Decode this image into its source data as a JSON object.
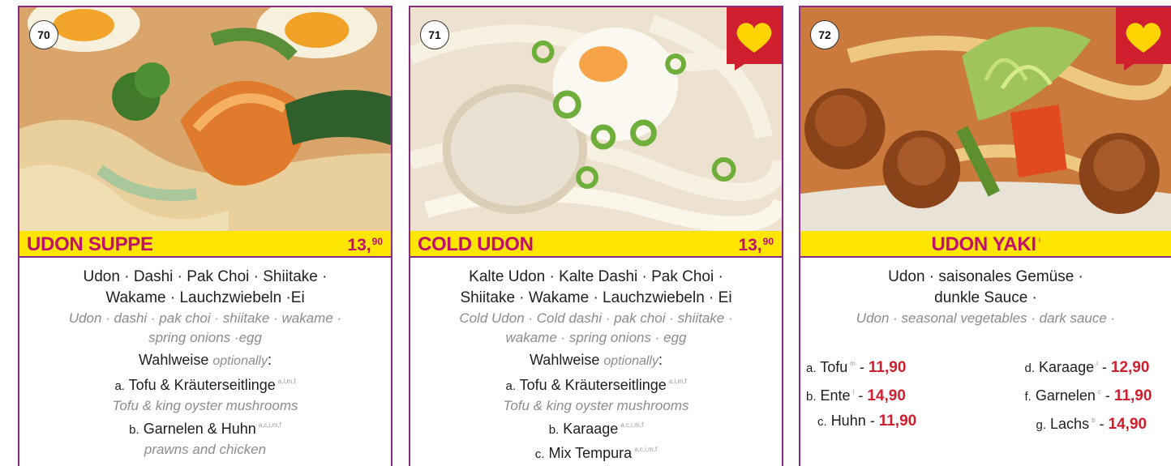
{
  "colors": {
    "border": "#8a2b86",
    "title": "#c0106c",
    "bar": "#ffe600",
    "price_red": "#cf1f2e",
    "heart_bg": "#cf1f2e",
    "heart": "#ffd400"
  },
  "cards": [
    {
      "number": "70",
      "name": "UDON SUPPE",
      "price_main": "13,",
      "price_cents": "90",
      "de": [
        "Udon · Dashi · Pak Choi · Shiitake ·",
        "Wakame · Lauchzwiebeln ·Ei"
      ],
      "en": [
        "Udon · dashi · pak choi · shiitake · wakame ·",
        "spring onions ·egg"
      ],
      "optional_de": "Wahlweise",
      "optional_en": "optionally",
      "options": [
        {
          "letter": "a.",
          "name": "Tofu & Kräuterseitlinge",
          "allergens": "a,i,m,f",
          "en": "Tofu & king oyster mushrooms"
        },
        {
          "letter": "b.",
          "name": "Garnelen & Huhn",
          "allergens": "a,c,i,m,f",
          "en": "prawns and chicken"
        }
      ]
    },
    {
      "number": "71",
      "name": "COLD UDON",
      "price_main": "13,",
      "price_cents": "90",
      "de": [
        "Kalte Udon · Kalte Dashi · Pak Choi ·",
        "Shiitake · Wakame · Lauchzwiebeln · Ei"
      ],
      "en": [
        "Cold Udon · Cold dashi · pak choi · shiitake ·",
        "wakame · spring onions · egg"
      ],
      "optional_de": "Wahlweise",
      "optional_en": "optionally",
      "options": [
        {
          "letter": "a.",
          "name": "Tofu & Kräuterseitlinge",
          "allergens": "a,i,m,f",
          "en": "Tofu & king oyster mushrooms"
        },
        {
          "letter": "b.",
          "name": "Karaage",
          "allergens": "a,c,i,m,f",
          "en": ""
        },
        {
          "letter": "c.",
          "name": "Mix Tempura",
          "allergens": "a,c,i,m,f",
          "en": ""
        }
      ]
    },
    {
      "number": "72",
      "name": "UDON YAKI",
      "name_allergen": "i",
      "de": [
        "Udon · saisonales Gemüse ·",
        "dunkle Sauce ·"
      ],
      "en": [
        "Udon · seasonal vegetables · dark sauce ·"
      ],
      "options": [
        {
          "letter": "a.",
          "name": "Tofu",
          "allergens": "m",
          "price": "11,90"
        },
        {
          "letter": "d.",
          "name": "Karaage",
          "allergens": "i",
          "price": "12,90"
        },
        {
          "letter": "b.",
          "name": "Ente",
          "allergens": "i",
          "price": "14,90"
        },
        {
          "letter": "f.",
          "name": "Garnelen",
          "allergens": "c",
          "price": "11,90"
        },
        {
          "letter": "c.",
          "name": "Huhn",
          "allergens": "",
          "price": "11,90"
        },
        {
          "letter": "g.",
          "name": "Lachs",
          "allergens": "b",
          "price": "14,90"
        }
      ]
    }
  ]
}
